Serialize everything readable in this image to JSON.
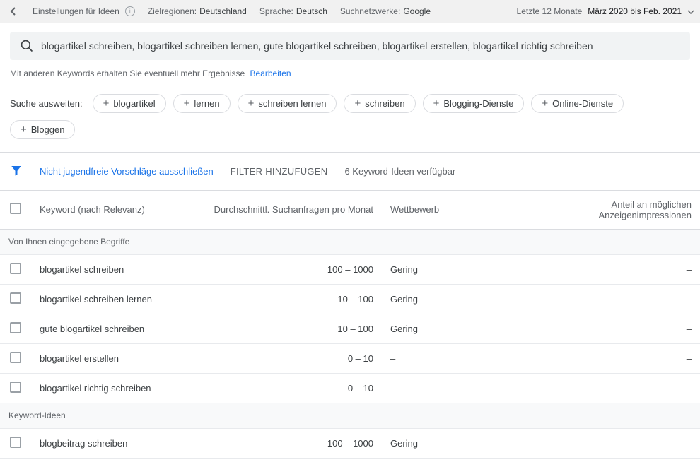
{
  "topbar": {
    "settings_label": "Einstellungen für Ideen",
    "region_label": "Zielregionen:",
    "region_value": "Deutschland",
    "language_label": "Sprache:",
    "language_value": "Deutsch",
    "network_label": "Suchnetzwerke:",
    "network_value": "Google",
    "period_label": "Letzte 12 Monate",
    "period_value": "März 2020 bis Feb. 2021"
  },
  "search": {
    "query": "blogartikel schreiben, blogartikel schreiben lernen, gute blogartikel schreiben, blogartikel erstellen, blogartikel richtig schreiben",
    "note": "Mit anderen Keywords erhalten Sie eventuell mehr Ergebnisse",
    "edit_link": "Bearbeiten"
  },
  "expand": {
    "label": "Suche ausweiten:",
    "chips": [
      "blogartikel",
      "lernen",
      "schreiben lernen",
      "schreiben",
      "Blogging-Dienste",
      "Online-Dienste",
      "Bloggen"
    ]
  },
  "filters": {
    "exclude": "Nicht jugendfreie Vorschläge ausschließen",
    "add_filter": "FILTER HINZUFÜGEN",
    "status": "6 Keyword-Ideen verfügbar"
  },
  "table": {
    "headers": {
      "keyword": "Keyword (nach Relevanz)",
      "volume": "Durchschnittl. Suchanfragen pro Monat",
      "competition": "Wettbewerb",
      "impressions": "Anteil an möglichen Anzeigenimpressionen"
    },
    "section1": "Von Ihnen eingegebene Begriffe",
    "rows1": [
      {
        "kw": "blogartikel schreiben",
        "vol": "100 – 1000",
        "comp": "Gering",
        "imp": "–"
      },
      {
        "kw": "blogartikel schreiben lernen",
        "vol": "10 – 100",
        "comp": "Gering",
        "imp": "–"
      },
      {
        "kw": "gute blogartikel schreiben",
        "vol": "10 – 100",
        "comp": "Gering",
        "imp": "–"
      },
      {
        "kw": "blogartikel erstellen",
        "vol": "0 – 10",
        "comp": "–",
        "imp": "–"
      },
      {
        "kw": "blogartikel richtig schreiben",
        "vol": "0 – 10",
        "comp": "–",
        "imp": "–"
      }
    ],
    "section2": "Keyword-Ideen",
    "rows2": [
      {
        "kw": "blogbeitrag schreiben",
        "vol": "100 – 1000",
        "comp": "Gering",
        "imp": "–"
      }
    ]
  }
}
